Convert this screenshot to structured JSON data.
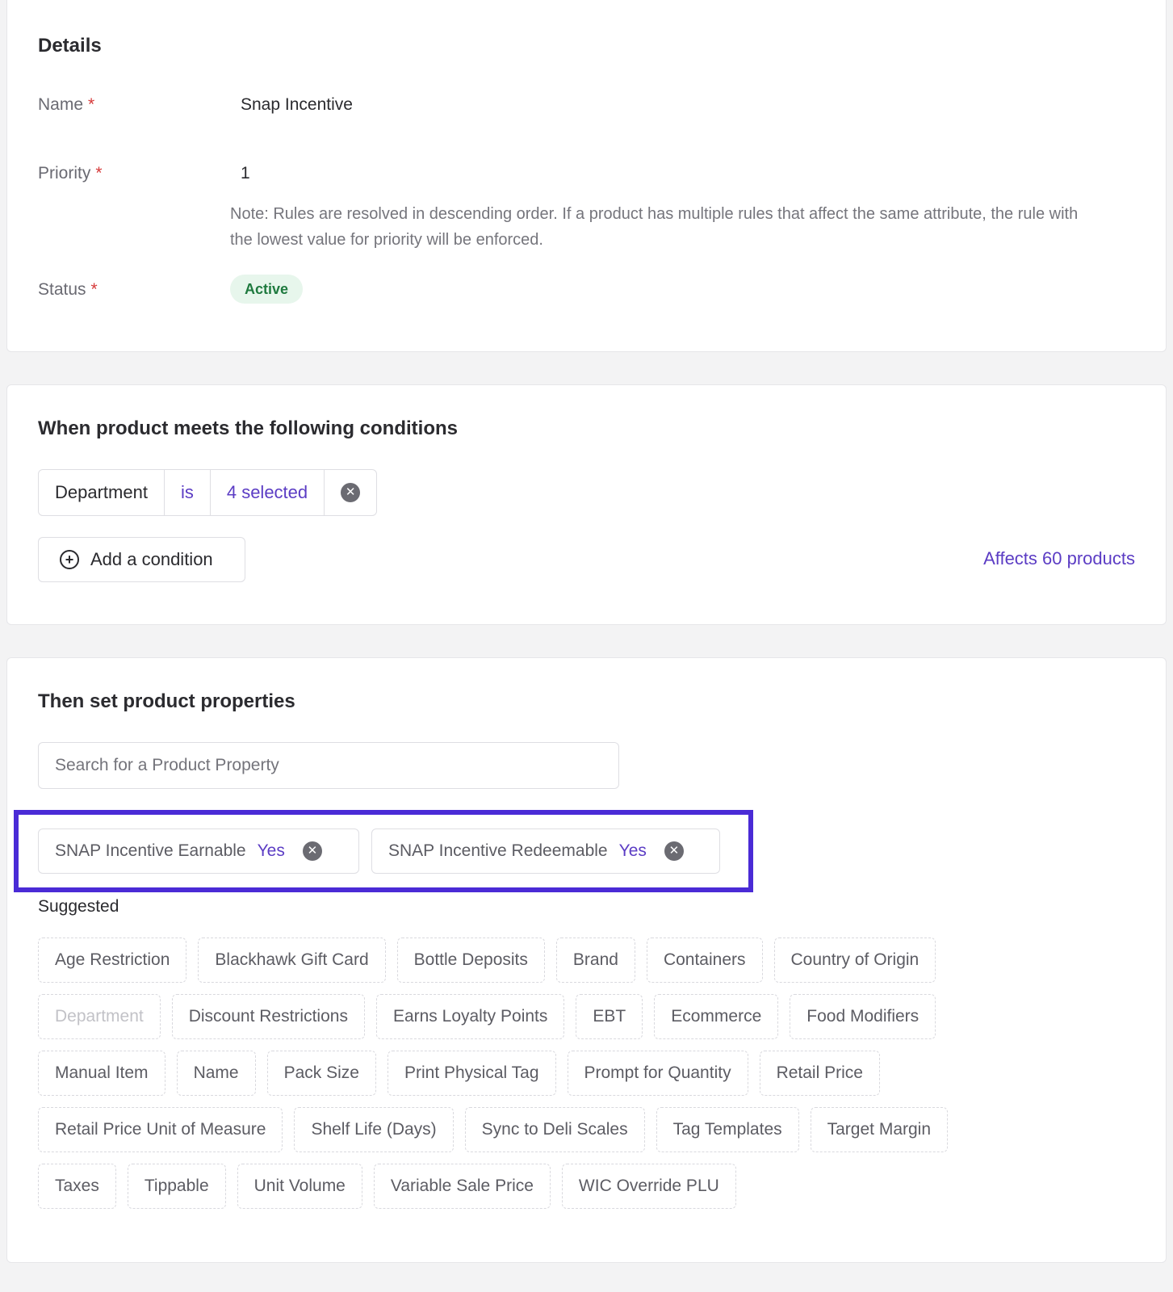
{
  "details": {
    "title": "Details",
    "name_label": "Name",
    "name_value": "Snap Incentive",
    "priority_label": "Priority",
    "priority_value": "1",
    "priority_note": "Note: Rules are resolved in descending order. If a product has multiple rules that affect the same attribute, the rule with the lowest value for priority will be enforced.",
    "status_label": "Status",
    "status_value": "Active",
    "required_marker": "*"
  },
  "conditions": {
    "title": "When product meets the following conditions",
    "rule": {
      "field": "Department",
      "operator": "is",
      "value": "4 selected",
      "remove_icon": "close-circle-icon"
    },
    "add_label": "Add a condition",
    "add_icon": "plus-circle-icon",
    "affects_label": "Affects 60 products"
  },
  "properties": {
    "title": "Then set product properties",
    "search_placeholder": "Search for a Product Property",
    "selected": [
      {
        "label": "SNAP Incentive Earnable",
        "value": "Yes"
      },
      {
        "label": "SNAP Incentive Redeemable",
        "value": "Yes"
      }
    ],
    "highlight_color": "#4a2bd6",
    "suggested_label": "Suggested",
    "suggested_rows": [
      [
        "Age Restriction",
        "Blackhawk Gift Card",
        "Bottle Deposits",
        "Brand",
        "Containers",
        "Country of Origin"
      ],
      [
        "Department",
        "Discount Restrictions",
        "Earns Loyalty Points",
        "EBT",
        "Ecommerce",
        "Food Modifiers"
      ],
      [
        "Manual Item",
        "Name",
        "Pack Size",
        "Print Physical Tag",
        "Prompt for Quantity",
        "Retail Price"
      ],
      [
        "Retail Price Unit of Measure",
        "Shelf Life (Days)",
        "Sync to Deli Scales",
        "Tag Templates",
        "Target Margin"
      ],
      [
        "Taxes",
        "Tippable",
        "Unit Volume",
        "Variable Sale Price",
        "WIC Override PLU"
      ]
    ],
    "disabled_suggestions": [
      "Department"
    ]
  },
  "colors": {
    "accent": "#5b3cc4",
    "required": "#d63a3a",
    "active_badge_bg": "#e7f6ec",
    "active_badge_text": "#1f7a3f"
  }
}
